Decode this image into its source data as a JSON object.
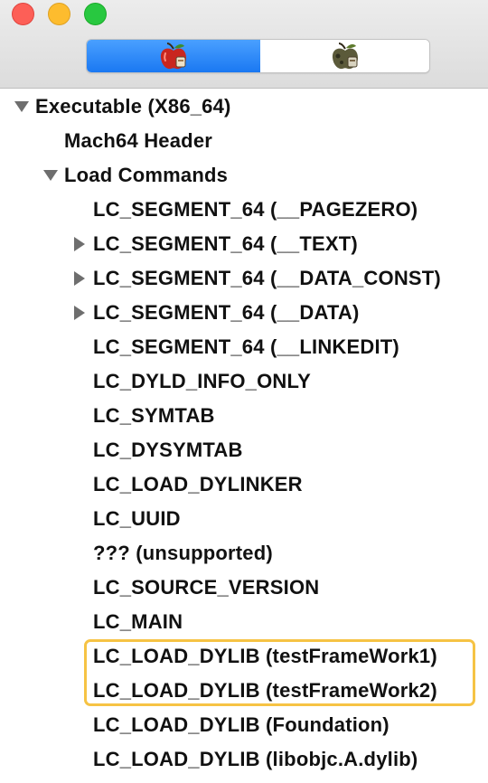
{
  "window": {
    "traffic_lights": [
      {
        "name": "close",
        "color": "#fd5f57"
      },
      {
        "name": "minimize",
        "color": "#fdbc2e"
      },
      {
        "name": "zoom",
        "color": "#28c840"
      }
    ]
  },
  "toolbar": {
    "segments": [
      {
        "icon": "red-apple-icon",
        "selected": true,
        "accent": "#1a78f2"
      },
      {
        "icon": "rotten-apple-icon",
        "selected": false
      }
    ]
  },
  "tree": {
    "root": {
      "label": "Executable  (X86_64)",
      "expanded": true
    },
    "mach_header": {
      "label": "Mach64 Header"
    },
    "load_commands": {
      "label": "Load Commands",
      "expanded": true,
      "items": [
        {
          "label": "LC_SEGMENT_64 (__PAGEZERO)",
          "expandable": false
        },
        {
          "label": "LC_SEGMENT_64 (__TEXT)",
          "expandable": true
        },
        {
          "label": "LC_SEGMENT_64 (__DATA_CONST)",
          "expandable": true
        },
        {
          "label": "LC_SEGMENT_64 (__DATA)",
          "expandable": true
        },
        {
          "label": "LC_SEGMENT_64 (__LINKEDIT)",
          "expandable": false
        },
        {
          "label": "LC_DYLD_INFO_ONLY",
          "expandable": false
        },
        {
          "label": "LC_SYMTAB",
          "expandable": false
        },
        {
          "label": "LC_DYSYMTAB",
          "expandable": false
        },
        {
          "label": "LC_LOAD_DYLINKER",
          "expandable": false
        },
        {
          "label": "LC_UUID",
          "expandable": false
        },
        {
          "label": "??? (unsupported)",
          "expandable": false
        },
        {
          "label": "LC_SOURCE_VERSION",
          "expandable": false
        },
        {
          "label": "LC_MAIN",
          "expandable": false
        },
        {
          "label": "LC_LOAD_DYLIB (testFrameWork1)",
          "expandable": false
        },
        {
          "label": "LC_LOAD_DYLIB (testFrameWork2)",
          "expandable": false
        },
        {
          "label": "LC_LOAD_DYLIB (Foundation)",
          "expandable": false
        },
        {
          "label": "LC_LOAD_DYLIB (libobjc.A.dylib)",
          "expandable": false
        }
      ]
    },
    "highlight_color": "#f6c344"
  }
}
